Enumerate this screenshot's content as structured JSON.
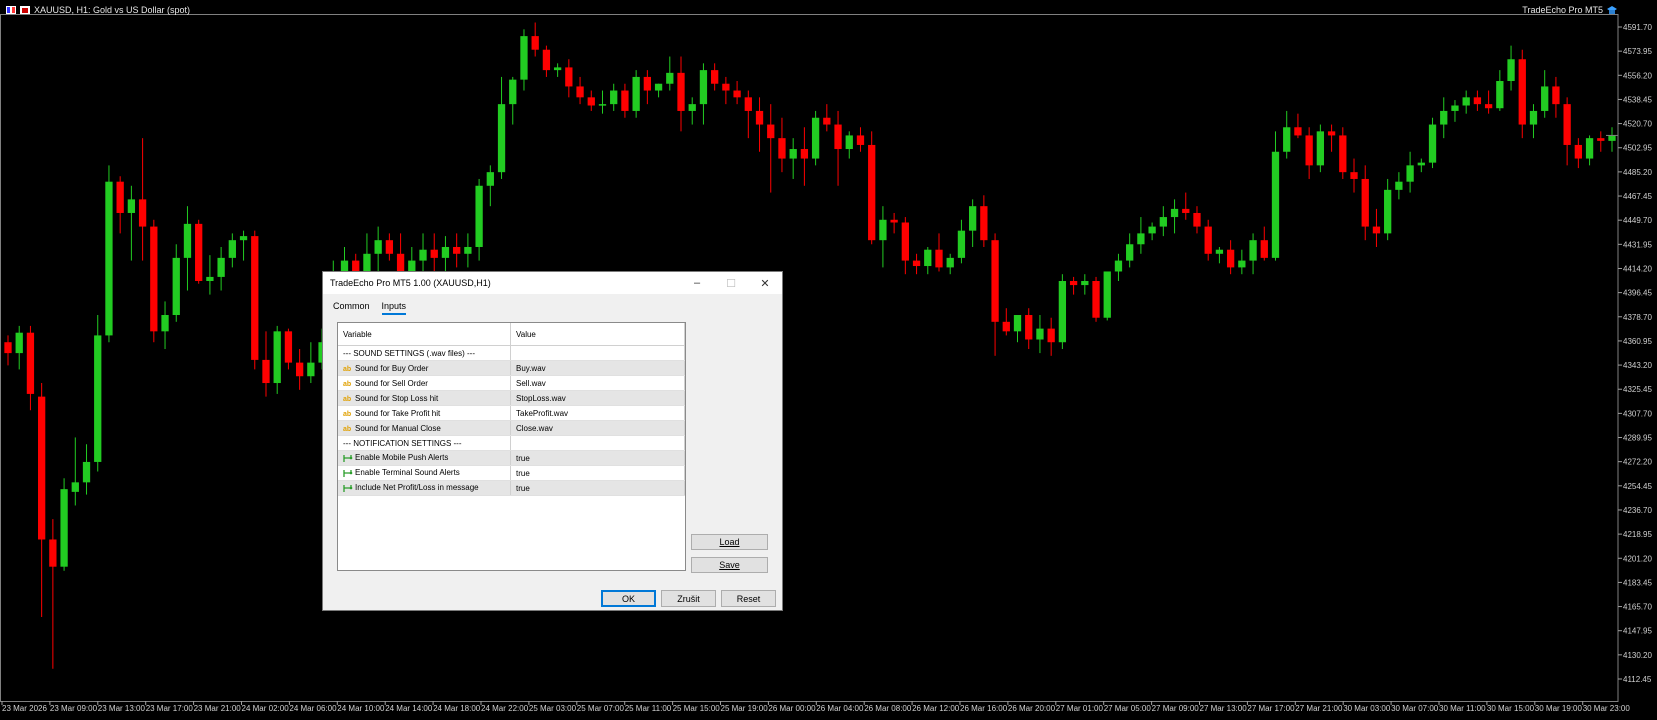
{
  "chart": {
    "symbol_title": "XAUUSD, H1:  Gold vs US Dollar (spot)",
    "ea_label": "TradeEcho Pro MT5",
    "bull_color": "#22cc22",
    "bear_color": "#ff0000",
    "price_labels": [
      "4591.70",
      "4573.95",
      "4556.20",
      "4538.45",
      "4520.70",
      "4502.95",
      "4485.20",
      "4467.45",
      "4449.70",
      "4431.95",
      "4414.20",
      "4396.45",
      "4378.70",
      "4360.95",
      "4343.20",
      "4325.45",
      "4307.70",
      "4289.95",
      "4272.20",
      "4254.45",
      "4236.70",
      "4218.95",
      "4201.20",
      "4183.45",
      "4165.70",
      "4147.95",
      "4130.20",
      "4112.45"
    ],
    "time_labels": [
      "23 Mar 2026",
      "23 Mar 09:00",
      "23 Mar 13:00",
      "23 Mar 17:00",
      "23 Mar 21:00",
      "24 Mar 02:00",
      "24 Mar 06:00",
      "24 Mar 10:00",
      "24 Mar 14:00",
      "24 Mar 18:00",
      "24 Mar 22:00",
      "25 Mar 03:00",
      "25 Mar 07:00",
      "25 Mar 11:00",
      "25 Mar 15:00",
      "25 Mar 19:00",
      "26 Mar 00:00",
      "26 Mar 04:00",
      "26 Mar 08:00",
      "26 Mar 12:00",
      "26 Mar 16:00",
      "26 Mar 20:00",
      "27 Mar 01:00",
      "27 Mar 05:00",
      "27 Mar 09:00",
      "27 Mar 13:00",
      "27 Mar 17:00",
      "27 Mar 21:00",
      "30 Mar 03:00",
      "30 Mar 07:00",
      "30 Mar 11:00",
      "30 Mar 15:00",
      "30 Mar 19:00",
      "30 Mar 23:00"
    ],
    "price_max": 4591.7,
    "price_min": 4112.45,
    "candles": [
      [
        4360,
        4365,
        4343,
        4352
      ],
      [
        4352,
        4372,
        4340,
        4367
      ],
      [
        4367,
        4372,
        4310,
        4322
      ],
      [
        4320,
        4330,
        4158,
        4215
      ],
      [
        4215,
        4230,
        4120,
        4195
      ],
      [
        4195,
        4260,
        4192,
        4252
      ],
      [
        4250,
        4290,
        4240,
        4257
      ],
      [
        4257,
        4285,
        4248,
        4272
      ],
      [
        4272,
        4380,
        4265,
        4365
      ],
      [
        4365,
        4490,
        4360,
        4478
      ],
      [
        4478,
        4482,
        4440,
        4455
      ],
      [
        4455,
        4475,
        4420,
        4465
      ],
      [
        4465,
        4510,
        4420,
        4445
      ],
      [
        4445,
        4450,
        4360,
        4368
      ],
      [
        4368,
        4390,
        4355,
        4380
      ],
      [
        4380,
        4432,
        4375,
        4422
      ],
      [
        4422,
        4460,
        4398,
        4447
      ],
      [
        4447,
        4450,
        4403,
        4405
      ],
      [
        4405,
        4424,
        4395,
        4408
      ],
      [
        4408,
        4430,
        4398,
        4422
      ],
      [
        4422,
        4440,
        4415,
        4435
      ],
      [
        4435,
        4442,
        4420,
        4438
      ],
      [
        4438,
        4442,
        4340,
        4347
      ],
      [
        4347,
        4368,
        4320,
        4330
      ],
      [
        4330,
        4372,
        4322,
        4368
      ],
      [
        4368,
        4370,
        4340,
        4345
      ],
      [
        4345,
        4355,
        4325,
        4335
      ],
      [
        4335,
        4360,
        4330,
        4345
      ],
      [
        4345,
        4370,
        4340,
        4360
      ],
      [
        4360,
        4420,
        4355,
        4392
      ],
      [
        4392,
        4430,
        4385,
        4420
      ],
      [
        4420,
        4425,
        4400,
        4408
      ],
      [
        4408,
        4440,
        4400,
        4425
      ],
      [
        4425,
        4445,
        4405,
        4435
      ],
      [
        4435,
        4440,
        4420,
        4425
      ],
      [
        4425,
        4440,
        4400,
        4412
      ],
      [
        4412,
        4430,
        4405,
        4420
      ],
      [
        4420,
        4440,
        4410,
        4428
      ],
      [
        4428,
        4440,
        4410,
        4422
      ],
      [
        4422,
        4438,
        4412,
        4430
      ],
      [
        4430,
        4440,
        4415,
        4425
      ],
      [
        4425,
        4440,
        4415,
        4430
      ],
      [
        4430,
        4480,
        4420,
        4475
      ],
      [
        4475,
        4490,
        4460,
        4485
      ],
      [
        4485,
        4555,
        4480,
        4535
      ],
      [
        4535,
        4555,
        4520,
        4553
      ],
      [
        4553,
        4590,
        4545,
        4585
      ],
      [
        4585,
        4595,
        4570,
        4575
      ],
      [
        4575,
        4578,
        4555,
        4560
      ],
      [
        4560,
        4565,
        4555,
        4562
      ],
      [
        4562,
        4568,
        4540,
        4548
      ],
      [
        4548,
        4555,
        4535,
        4540
      ],
      [
        4540,
        4545,
        4530,
        4534
      ],
      [
        4534,
        4545,
        4528,
        4535
      ],
      [
        4535,
        4550,
        4530,
        4545
      ],
      [
        4545,
        4550,
        4525,
        4530
      ],
      [
        4530,
        4560,
        4525,
        4555
      ],
      [
        4555,
        4560,
        4535,
        4545
      ],
      [
        4545,
        4550,
        4540,
        4550
      ],
      [
        4550,
        4570,
        4545,
        4558
      ],
      [
        4558,
        4570,
        4515,
        4530
      ],
      [
        4530,
        4540,
        4520,
        4535
      ],
      [
        4535,
        4565,
        4520,
        4560
      ],
      [
        4560,
        4565,
        4545,
        4550
      ],
      [
        4550,
        4555,
        4535,
        4545
      ],
      [
        4545,
        4552,
        4535,
        4540
      ],
      [
        4540,
        4545,
        4510,
        4530
      ],
      [
        4530,
        4540,
        4500,
        4520
      ],
      [
        4520,
        4535,
        4470,
        4510
      ],
      [
        4510,
        4525,
        4485,
        4495
      ],
      [
        4495,
        4510,
        4480,
        4502
      ],
      [
        4502,
        4518,
        4475,
        4495
      ],
      [
        4495,
        4530,
        4490,
        4525
      ],
      [
        4525,
        4535,
        4515,
        4520
      ],
      [
        4520,
        4530,
        4475,
        4502
      ],
      [
        4502,
        4515,
        4495,
        4512
      ],
      [
        4512,
        4518,
        4500,
        4505
      ],
      [
        4505,
        4515,
        4432,
        4435
      ],
      [
        4435,
        4460,
        4415,
        4450
      ],
      [
        4450,
        4455,
        4440,
        4448
      ],
      [
        4448,
        4452,
        4410,
        4420
      ],
      [
        4420,
        4425,
        4410,
        4416
      ],
      [
        4416,
        4430,
        4410,
        4428
      ],
      [
        4428,
        4440,
        4412,
        4415
      ],
      [
        4415,
        4425,
        4410,
        4422
      ],
      [
        4422,
        4450,
        4418,
        4442
      ],
      [
        4442,
        4465,
        4430,
        4460
      ],
      [
        4460,
        4468,
        4430,
        4435
      ],
      [
        4435,
        4440,
        4350,
        4375
      ],
      [
        4375,
        4385,
        4365,
        4368
      ],
      [
        4368,
        4378,
        4360,
        4380
      ],
      [
        4380,
        4385,
        4355,
        4362
      ],
      [
        4362,
        4380,
        4352,
        4370
      ],
      [
        4370,
        4378,
        4350,
        4360
      ],
      [
        4360,
        4410,
        4355,
        4405
      ],
      [
        4405,
        4408,
        4395,
        4402
      ],
      [
        4402,
        4410,
        4395,
        4405
      ],
      [
        4405,
        4408,
        4375,
        4378
      ],
      [
        4378,
        4405,
        4376,
        4412
      ],
      [
        4412,
        4425,
        4405,
        4420
      ],
      [
        4420,
        4440,
        4415,
        4432
      ],
      [
        4432,
        4452,
        4425,
        4440
      ],
      [
        4440,
        4448,
        4435,
        4445
      ],
      [
        4445,
        4460,
        4438,
        4452
      ],
      [
        4452,
        4465,
        4440,
        4458
      ],
      [
        4458,
        4470,
        4450,
        4455
      ],
      [
        4455,
        4460,
        4440,
        4445
      ],
      [
        4445,
        4450,
        4420,
        4425
      ],
      [
        4425,
        4430,
        4418,
        4428
      ],
      [
        4428,
        4435,
        4410,
        4415
      ],
      [
        4415,
        4428,
        4410,
        4420
      ],
      [
        4420,
        4440,
        4410,
        4435
      ],
      [
        4435,
        4445,
        4420,
        4422
      ],
      [
        4422,
        4515,
        4420,
        4500
      ],
      [
        4500,
        4530,
        4495,
        4518
      ],
      [
        4518,
        4528,
        4510,
        4512
      ],
      [
        4512,
        4518,
        4480,
        4490
      ],
      [
        4490,
        4520,
        4485,
        4515
      ],
      [
        4515,
        4520,
        4500,
        4512
      ],
      [
        4512,
        4518,
        4480,
        4485
      ],
      [
        4485,
        4495,
        4470,
        4480
      ],
      [
        4480,
        4490,
        4435,
        4445
      ],
      [
        4445,
        4458,
        4430,
        4440
      ],
      [
        4440,
        4480,
        4435,
        4472
      ],
      [
        4472,
        4485,
        4465,
        4478
      ],
      [
        4478,
        4500,
        4470,
        4490
      ],
      [
        4490,
        4495,
        4485,
        4492
      ],
      [
        4492,
        4525,
        4488,
        4520
      ],
      [
        4520,
        4540,
        4510,
        4530
      ],
      [
        4530,
        4538,
        4522,
        4534
      ],
      [
        4534,
        4545,
        4528,
        4540
      ],
      [
        4540,
        4545,
        4530,
        4535
      ],
      [
        4535,
        4545,
        4528,
        4532
      ],
      [
        4532,
        4560,
        4530,
        4552
      ],
      [
        4552,
        4578,
        4545,
        4568
      ],
      [
        4568,
        4575,
        4510,
        4520
      ],
      [
        4520,
        4535,
        4510,
        4530
      ],
      [
        4530,
        4560,
        4525,
        4548
      ],
      [
        4548,
        4555,
        4525,
        4535
      ],
      [
        4535,
        4540,
        4490,
        4505
      ],
      [
        4505,
        4510,
        4488,
        4495
      ],
      [
        4495,
        4512,
        4490,
        4510
      ],
      [
        4510,
        4515,
        4500,
        4508
      ],
      [
        4508,
        4518,
        4500,
        4512
      ]
    ]
  },
  "dialog": {
    "title": "TradeEcho Pro MT5 1.00 (XAUUSD,H1)",
    "minimize": "–",
    "maximize": "☐",
    "close": "✕",
    "tabs": [
      "Common",
      "Inputs"
    ],
    "active_tab": 1,
    "grid": {
      "headers": [
        "Variable",
        "Value"
      ],
      "rows": [
        {
          "icon": "",
          "variable": "--- SOUND SETTINGS (.wav files) ---",
          "value": ""
        },
        {
          "icon": "ab",
          "variable": "Sound for Buy Order",
          "value": "Buy.wav"
        },
        {
          "icon": "ab",
          "variable": "Sound for Sell Order",
          "value": "Sell.wav"
        },
        {
          "icon": "ab",
          "variable": "Sound for Stop Loss hit",
          "value": "StopLoss.wav"
        },
        {
          "icon": "ab",
          "variable": "Sound for Take Profit hit",
          "value": "TakeProfit.wav"
        },
        {
          "icon": "ab",
          "variable": "Sound for Manual Close",
          "value": "Close.wav"
        },
        {
          "icon": "",
          "variable": "--- NOTIFICATION SETTINGS ---",
          "value": ""
        },
        {
          "icon": "bool",
          "variable": "Enable Mobile Push Alerts",
          "value": "true"
        },
        {
          "icon": "bool",
          "variable": "Enable Terminal Sound Alerts",
          "value": "true"
        },
        {
          "icon": "bool",
          "variable": "Include Net Profit/Loss in message",
          "value": "true"
        }
      ]
    },
    "buttons": {
      "load": "Load",
      "save": "Save",
      "ok": "OK",
      "cancel": "Zrušit",
      "reset": "Reset"
    }
  }
}
